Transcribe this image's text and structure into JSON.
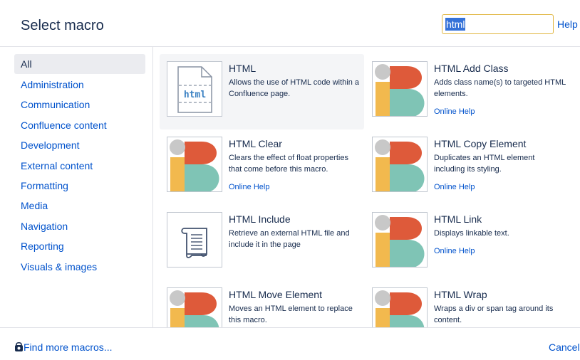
{
  "dialog": {
    "title": "Select macro",
    "search_value": "html",
    "help_label": "Help"
  },
  "sidebar": {
    "items": [
      {
        "label": "All",
        "active": true
      },
      {
        "label": "Administration"
      },
      {
        "label": "Communication"
      },
      {
        "label": "Confluence content"
      },
      {
        "label": "Development"
      },
      {
        "label": "External content"
      },
      {
        "label": "Formatting"
      },
      {
        "label": "Media"
      },
      {
        "label": "Navigation"
      },
      {
        "label": "Reporting"
      },
      {
        "label": "Visuals & images"
      }
    ]
  },
  "macros": [
    {
      "title": "HTML",
      "description": "Allows the use of HTML code within a Confluence page.",
      "help": "",
      "icon": "html-file-icon",
      "thumb_text": "html",
      "selected": true
    },
    {
      "title": "HTML Add Class",
      "description": "Adds class name(s) to targeted HTML elements.",
      "help": "Online Help",
      "icon": "ib-logo-icon"
    },
    {
      "title": "HTML Clear",
      "description": "Clears the effect of float properties that come before this macro.",
      "help": "Online Help",
      "icon": "ib-logo-icon"
    },
    {
      "title": "HTML Copy Element",
      "description": "Duplicates an HTML element including its styling.",
      "help": "Online Help",
      "icon": "ib-logo-icon"
    },
    {
      "title": "HTML Include",
      "description": "Retrieve an external HTML file and include it in the page",
      "help": "",
      "icon": "scroll-icon"
    },
    {
      "title": "HTML Link",
      "description": "Displays linkable text.",
      "help": "Online Help",
      "icon": "ib-logo-icon"
    },
    {
      "title": "HTML Move Element",
      "description": "Moves an HTML element to replace this macro.",
      "help": "",
      "icon": "ib-logo-icon"
    },
    {
      "title": "HTML Wrap",
      "description": "Wraps a div or span tag around its content.",
      "help": "",
      "icon": "ib-logo-icon"
    }
  ],
  "footer": {
    "find_more": "Find more macros...",
    "cancel": "Cancel"
  },
  "colors": {
    "link": "#0052cc",
    "text": "#172b4d",
    "logo_red": "#de5a3a",
    "logo_teal": "#7fc4b5",
    "logo_yellow": "#f2b94e",
    "logo_grey": "#c8c8c8"
  }
}
